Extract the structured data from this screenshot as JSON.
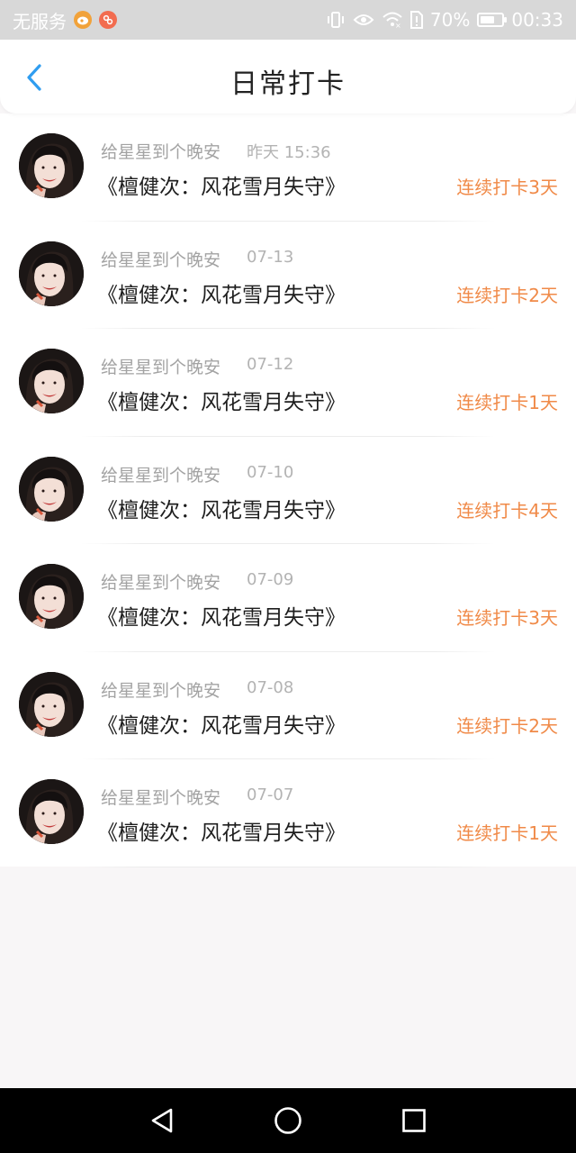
{
  "status_bar": {
    "carrier": "无服务",
    "battery_percent": "70%",
    "battery_level": 0.7,
    "time": "00:33",
    "icons": [
      "weibo-icon",
      "app-notification-icon",
      "vibrate-icon",
      "eye-icon",
      "wifi-icon",
      "sim-alert-icon",
      "battery-icon"
    ]
  },
  "header": {
    "title": "日常打卡",
    "back_icon": "chevron-left-icon"
  },
  "colors": {
    "accent": "#2f9df0",
    "streak": "#f08a48",
    "background": "#f8f6f7"
  },
  "checkins": [
    {
      "sender": "给星星到个晚安",
      "time": "昨天 15:36",
      "song": "《檀健次：风花雪月失守》",
      "streak": "连续打卡3天"
    },
    {
      "sender": "给星星到个晚安",
      "time": "07-13",
      "song": "《檀健次：风花雪月失守》",
      "streak": "连续打卡2天"
    },
    {
      "sender": "给星星到个晚安",
      "time": "07-12",
      "song": "《檀健次：风花雪月失守》",
      "streak": "连续打卡1天"
    },
    {
      "sender": "给星星到个晚安",
      "time": "07-10",
      "song": "《檀健次：风花雪月失守》",
      "streak": "连续打卡4天"
    },
    {
      "sender": "给星星到个晚安",
      "time": "07-09",
      "song": "《檀健次：风花雪月失守》",
      "streak": "连续打卡3天"
    },
    {
      "sender": "给星星到个晚安",
      "time": "07-08",
      "song": "《檀健次：风花雪月失守》",
      "streak": "连续打卡2天"
    },
    {
      "sender": "给星星到个晚安",
      "time": "07-07",
      "song": "《檀健次：风花雪月失守》",
      "streak": "连续打卡1天"
    }
  ],
  "nav_bar": {
    "icons": [
      "back-triangle-icon",
      "home-circle-icon",
      "recents-square-icon"
    ]
  }
}
